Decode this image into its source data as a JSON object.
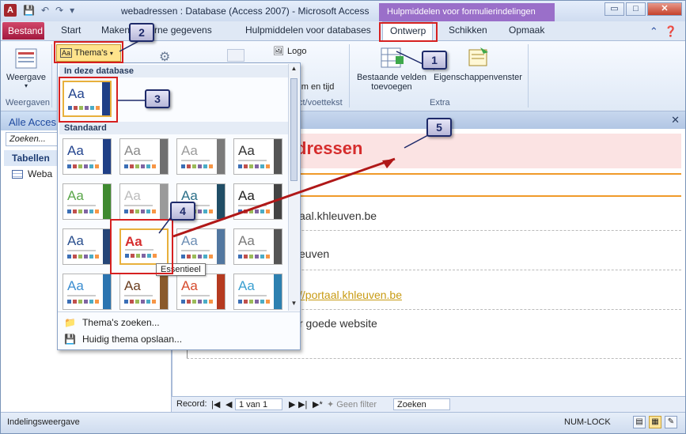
{
  "titlebar": {
    "app_icon_letter": "A",
    "title": "webadressen : Database (Access 2007)  -  Microsoft Access",
    "context_header": "Hulpmiddelen voor formulierindelingen",
    "minimize": "▭",
    "maximize": "□",
    "close": "✕"
  },
  "tabs": [
    {
      "label": "Bestand"
    },
    {
      "label": "Start"
    },
    {
      "label": "Maken"
    },
    {
      "label": "Externe gegevens"
    },
    {
      "label": "Hulpmiddelen voor databases"
    },
    {
      "label": "Ontwerp"
    },
    {
      "label": "Schikken"
    },
    {
      "label": "Opmaak"
    }
  ],
  "ribbon": {
    "weergave_label": "Weergave",
    "weergaven_group": "Weergaven",
    "themes_button": "Thema's",
    "logo": "Logo",
    "datum_en_tijd": "rum en tijd",
    "kop_voettekst_group": "ct/voettekst",
    "bestaande_velden": "Bestaande velden toevoegen",
    "eigenschappenvenster": "Eigenschappenvenster",
    "extra_group": "Extra"
  },
  "themes_dropdown": {
    "section_db": "In deze database",
    "section_std": "Standaard",
    "aa": "Aa",
    "tooltip": "Essentieel",
    "menu": [
      {
        "label": "Thema's zoeken..."
      },
      {
        "label": "Huidig thema opslaan..."
      }
    ]
  },
  "navpane": {
    "header": "Alle Acces",
    "search_placeholder": "Zoeken...",
    "group": "Tabellen",
    "item": "Weba"
  },
  "form": {
    "title_partial": "dressen",
    "line1": "aal.khleuven.be",
    "line2": "euven",
    "link": "//portaal.khleuven.be",
    "line4": "r goede website"
  },
  "record_nav": {
    "label": "Record:",
    "position": "1 van 1",
    "filter": "Geen filter",
    "search": "Zoeken"
  },
  "statusbar": {
    "left": "Indelingsweergave",
    "numlock": "NUM-LOCK"
  },
  "callouts": [
    "1",
    "2",
    "3",
    "4",
    "5"
  ],
  "theme_colors": {
    "accent": "#a3193e",
    "context": "#9a6fc9",
    "highlight": "#d62020",
    "title_red": "#d62d2d"
  }
}
